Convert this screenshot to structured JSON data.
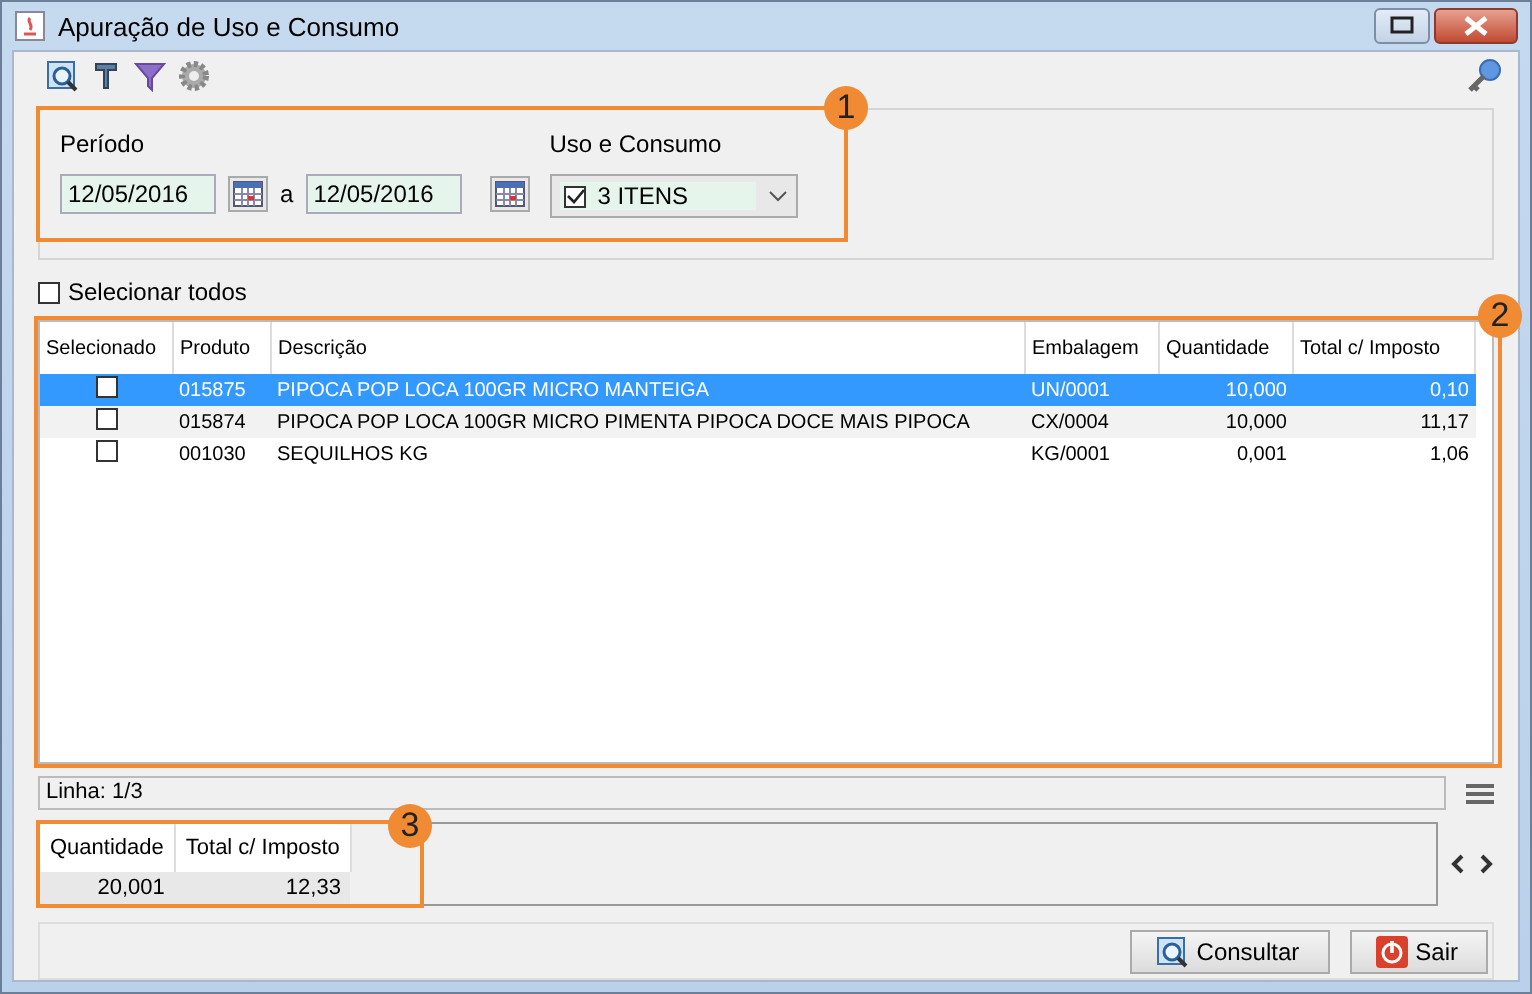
{
  "window": {
    "title": "Apuração de Uso e Consumo"
  },
  "filter": {
    "period_label": "Período",
    "date_from": "12/05/2016",
    "separator": "a",
    "date_to": "12/05/2016",
    "uso_label": "Uso e Consumo",
    "uso_combo": {
      "checked": true,
      "value": "3 ITENS"
    }
  },
  "select_all": {
    "label": "Selecionar todos",
    "checked": false
  },
  "table": {
    "columns": [
      "Selecionado",
      "Produto",
      "Descrição",
      "Embalagem",
      "Quantidade",
      "Total c/ Imposto"
    ],
    "rows": [
      {
        "selected": true,
        "checked": false,
        "produto": "015875",
        "descricao": "PIPOCA POP LOCA 100GR MICRO MANTEIGA",
        "embalagem": "UN/0001",
        "quantidade": "10,000",
        "total": "0,10"
      },
      {
        "selected": false,
        "checked": false,
        "produto": "015874",
        "descricao": "PIPOCA POP LOCA 100GR MICRO PIMENTA PIPOCA DOCE MAIS PIPOCA",
        "embalagem": "CX/0004",
        "quantidade": "10,000",
        "total": "11,17"
      },
      {
        "selected": false,
        "checked": false,
        "produto": "001030",
        "descricao": "SEQUILHOS KG",
        "embalagem": "KG/0001",
        "quantidade": "0,001",
        "total": "1,06"
      }
    ]
  },
  "status_bar": {
    "text": "Linha: 1/3"
  },
  "totals": {
    "columns": [
      "Quantidade",
      "Total c/ Imposto"
    ],
    "values": [
      "20,001",
      "12,33"
    ]
  },
  "buttons": [
    {
      "kind": "search",
      "label": "Consultar"
    },
    {
      "kind": "exit",
      "label": "Sair"
    }
  ],
  "callouts": [
    "1",
    "2",
    "3"
  ]
}
